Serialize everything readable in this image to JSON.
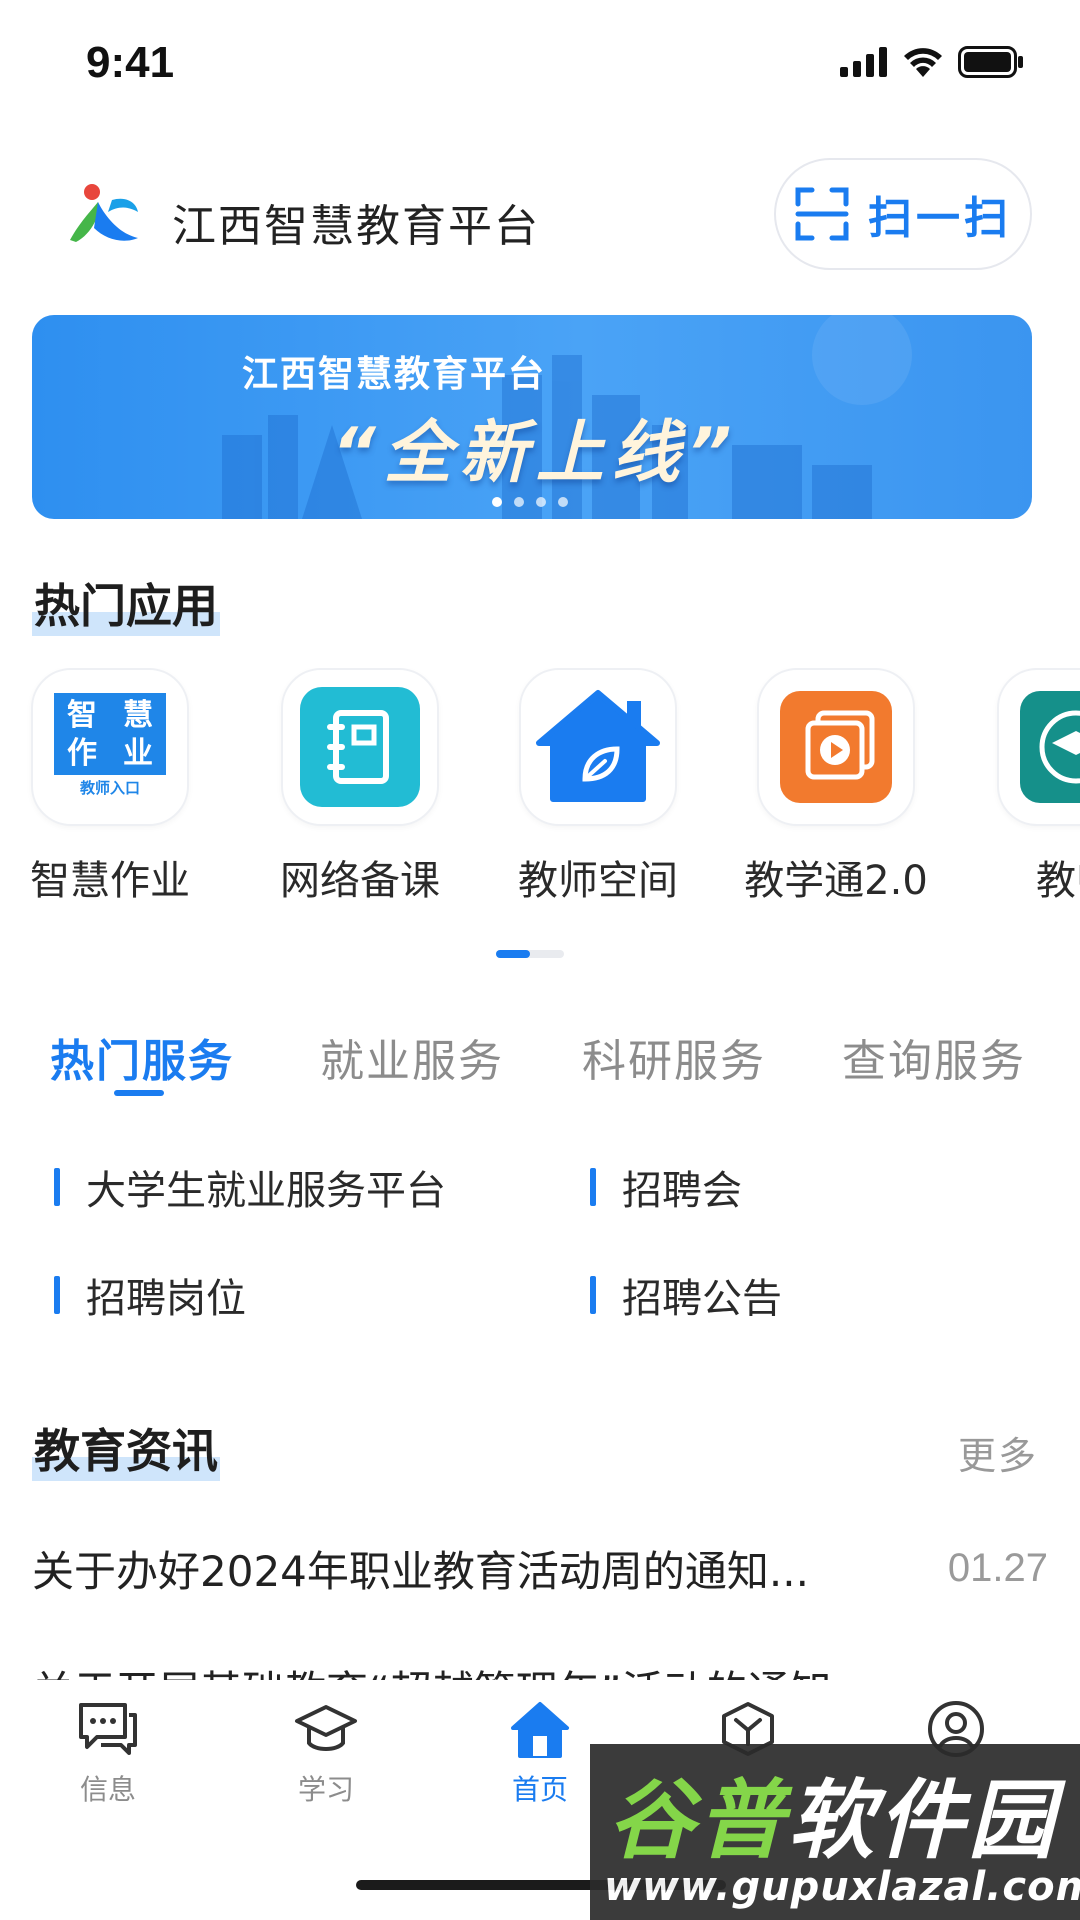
{
  "status_bar": {
    "time": "9:41"
  },
  "header": {
    "title": "江西智慧教育平台",
    "scan_label": "扫一扫"
  },
  "banner": {
    "subtitle": "江西智慧教育平台",
    "headline": "“全新上线”",
    "slide_count": 4,
    "active_slide": 1
  },
  "hot_apps": {
    "title": "热门应用",
    "items": [
      {
        "label": "智慧作业",
        "icon": "smart-homework-icon",
        "icon_text": [
          "智",
          "慧",
          "作",
          "业"
        ],
        "icon_caption": "教师入口",
        "color": "#1f86e8"
      },
      {
        "label": "网络备课",
        "icon": "notebook-icon",
        "color": "#22bcd4"
      },
      {
        "label": "教师空间",
        "icon": "house-leaf-icon",
        "color": "#1a7cf0"
      },
      {
        "label": "教学通2.0",
        "icon": "video-slides-icon",
        "color": "#f27a2e"
      },
      {
        "label": "教师",
        "icon": "graduation-cap-icon",
        "color": "#15908a"
      }
    ],
    "page_progress": 0.5
  },
  "services": {
    "tabs": [
      "热门服务",
      "就业服务",
      "科研服务",
      "查询服务"
    ],
    "active_tab": 0,
    "items": [
      "大学生就业服务平台",
      "招聘会",
      "招聘岗位",
      "招聘公告"
    ]
  },
  "news": {
    "title": "教育资讯",
    "more_label": "更多",
    "items": [
      {
        "title": "关于办好2024年职业教育活动周的通知...",
        "date": "01.27"
      },
      {
        "title": "关于开展基础教育“超越管理年”活动的通知",
        "date": ""
      }
    ]
  },
  "tab_bar": {
    "items": [
      {
        "label": "信息",
        "icon": "message-icon"
      },
      {
        "label": "学习",
        "icon": "graduation-cap-icon"
      },
      {
        "label": "首页",
        "icon": "home-icon"
      },
      {
        "label": "",
        "icon": "cube-icon"
      },
      {
        "label": "",
        "icon": "user-icon"
      }
    ],
    "active": 2
  },
  "watermark": {
    "text": "谷普软件园",
    "text_green": "谷普",
    "text_white": "软件园",
    "url": "www.gupuxlazal.com"
  },
  "colors": {
    "accent": "#1a7cf0",
    "text": "#222222",
    "muted": "#8c8c8c"
  }
}
